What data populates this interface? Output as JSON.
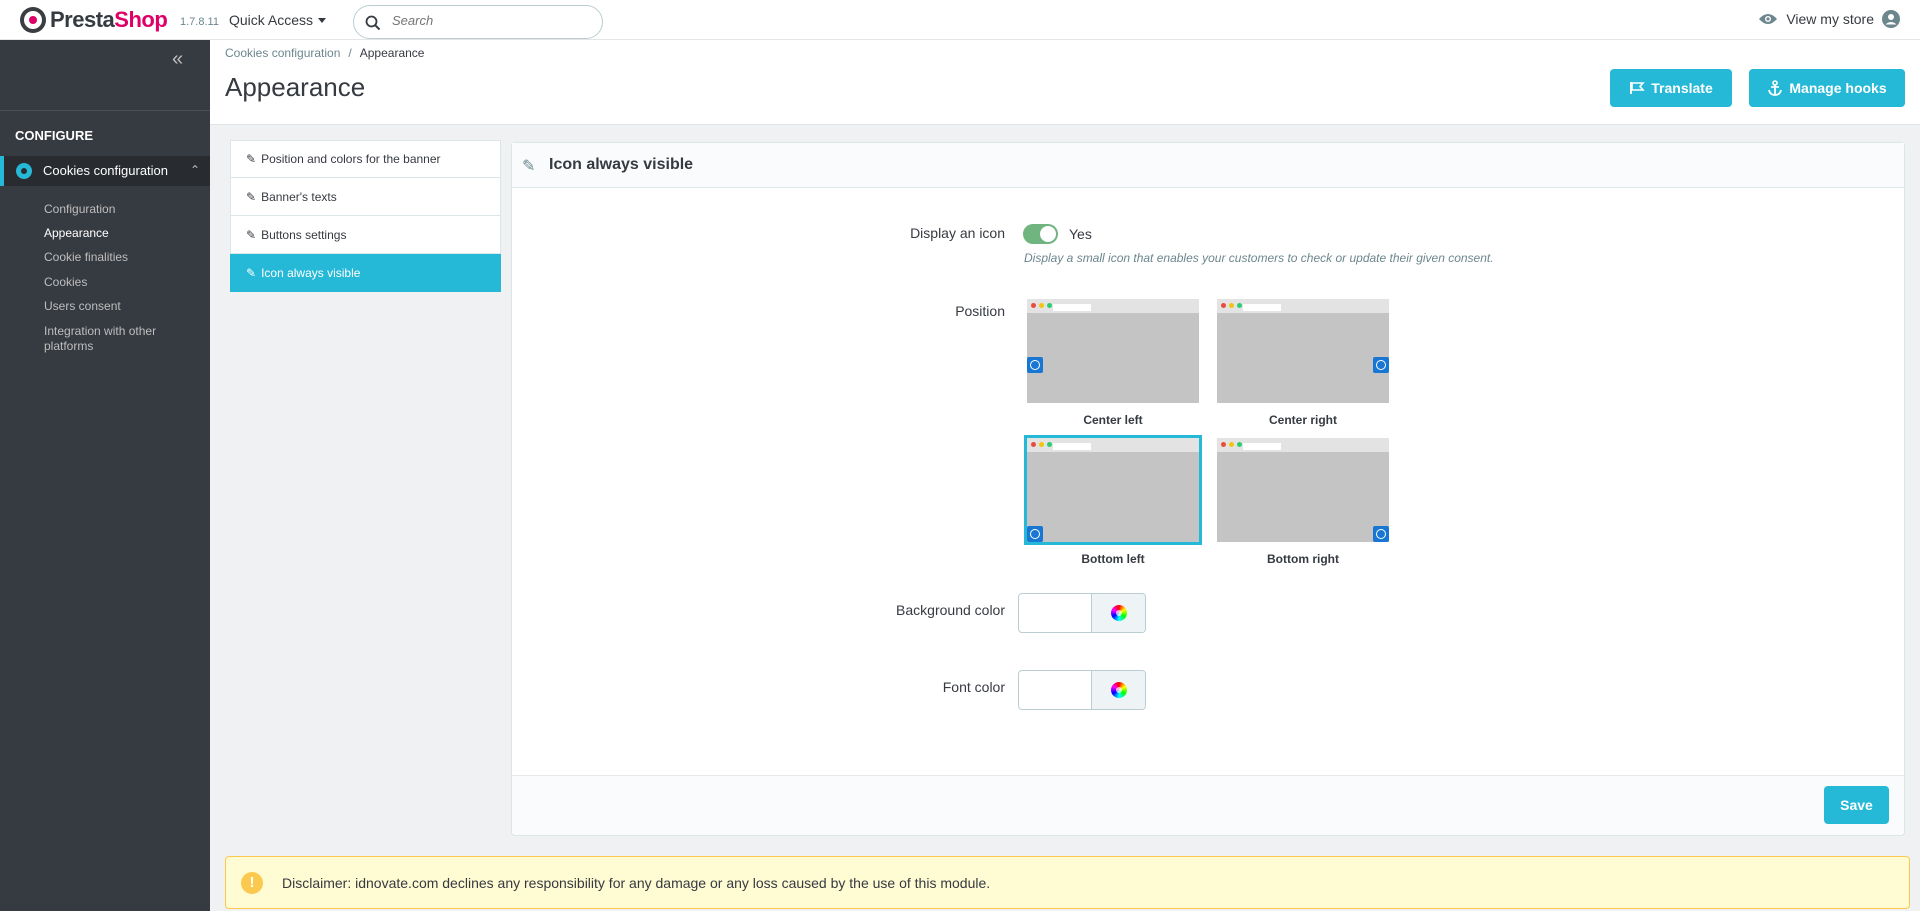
{
  "topbar": {
    "logo_presta": "Presta",
    "logo_shop": "Shop",
    "version": "1.7.8.11",
    "quick_access": "Quick Access",
    "search_placeholder": "Search",
    "view_store": "View my store"
  },
  "sidebar": {
    "section_title": "CONFIGURE",
    "active_item": "Cookies configuration",
    "sub_items": [
      "Configuration",
      "Appearance",
      "Cookie finalities",
      "Cookies",
      "Users consent",
      "Integration with other platforms"
    ]
  },
  "header": {
    "breadcrumb_parent": "Cookies configuration",
    "breadcrumb_separator": "/",
    "breadcrumb_current": "Appearance",
    "title": "Appearance",
    "translate_label": "Translate",
    "manage_hooks_label": "Manage hooks"
  },
  "tabs": [
    "Position and colors for the banner",
    "Banner's texts",
    "Buttons settings",
    "Icon always visible"
  ],
  "panel": {
    "title": "Icon always visible",
    "display_icon_label": "Display an icon",
    "display_icon_value": "Yes",
    "display_icon_help": "Display a small icon that enables your customers to check or update their given consent.",
    "position_label": "Position",
    "positions": [
      "Center left",
      "Center right",
      "Bottom left",
      "Bottom right"
    ],
    "selected_position": "Bottom left",
    "background_color_label": "Background color",
    "background_color_value": "",
    "font_color_label": "Font color",
    "font_color_value": "",
    "save_label": "Save"
  },
  "disclaimer": "Disclaimer: idnovate.com declines any responsibility for any damage or any loss caused by the use of this module.",
  "colors": {
    "accent": "#25b9d7",
    "sidebar": "#363a41",
    "toggle_on": "#70b580",
    "alert_bg": "#fffbd3"
  }
}
